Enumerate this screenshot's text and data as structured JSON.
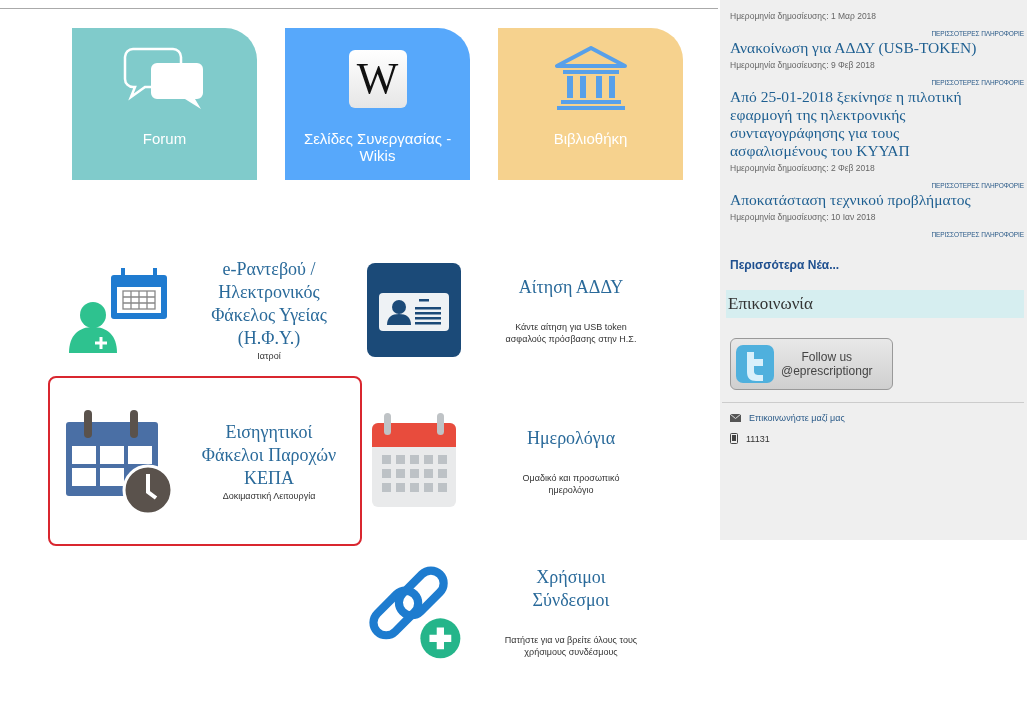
{
  "tiles": [
    {
      "kind": "forum",
      "label": "Forum",
      "color": "#80cbcb"
    },
    {
      "kind": "wiki",
      "label": "Σελίδες Συνεργασίας - Wikis",
      "color": "#57a8fb",
      "icon_text": "W"
    },
    {
      "kind": "library",
      "label": "Βιβλιοθήκη",
      "color": "#f6d28e"
    }
  ],
  "services": [
    {
      "kind": "doctor",
      "title": "e-Ραντεβού / Ηλεκτρονικός Φάκελος Υγείας (Η.Φ.Υ.)",
      "subtitle": "Ιατροί",
      "highlighted": false
    },
    {
      "kind": "card",
      "title": "Αίτηση ΑΔΔΥ",
      "subtitle": "Κάντε αίτηση για USB token ασφαλούς πρόσβασης στην Η.Σ.",
      "highlighted": false
    },
    {
      "kind": "calendar-clock",
      "title": "Εισηγητικοί Φάκελοι Παροχών ΚΕΠΑ",
      "subtitle": "Δοκιμαστική Λειτουργία",
      "highlighted": true
    },
    {
      "kind": "calendar",
      "title": "Ημερολόγια",
      "subtitle": "Ομαδικό και προσωπικό ημερολόγιο",
      "highlighted": false
    },
    {
      "kind": "empty"
    },
    {
      "kind": "links",
      "title": "Χρήσιμοι Σύνδεσμοι",
      "subtitle": "Πατήστε για να βρείτε όλους τους χρήσιμους συνδέσμους",
      "highlighted": false
    }
  ],
  "sidebar": {
    "news": [
      {
        "date": "Ημερομηνία δημοσίευσης: 1 Μαρ 2018",
        "more": "ΠΕΡΙΣΣΟΤΕΡΕΣ ΠΛΗΡΟΦΟΡΙΕ"
      },
      {
        "title": "Ανακοίνωση για ΑΔΔΥ (USB-TOKEN)",
        "date": "Ημερομηνία δημοσίευσης: 9 Φεβ 2018",
        "more": "ΠΕΡΙΣΣΟΤΕΡΕΣ ΠΛΗΡΟΦΟΡΙΕ"
      },
      {
        "title": "Από 25-01-2018 ξεκίνησε η πιλοτική εφαρμογή της ηλεκτρονικής συνταγογράφησης για τους ασφαλισμένους του ΚΥΥΑΠ",
        "date": "Ημερομηνία δημοσίευσης: 2 Φεβ 2018",
        "more": "ΠΕΡΙΣΣΟΤΕΡΕΣ ΠΛΗΡΟΦΟΡΙΕ"
      },
      {
        "title": "Αποκατάσταση τεχνικού προβλήματος",
        "date": "Ημερομηνία δημοσίευσης: 10 Ιαν 2018",
        "more": "ΠΕΡΙΣΣΟΤΕΡΕΣ ΠΛΗΡΟΦΟΡΙΕ"
      }
    ],
    "more_news": "Περισσότερα Νέα...",
    "contact_heading": "Επικοινωνία",
    "twitter": {
      "line1": "Follow us",
      "line2": "@eprescriptiongr"
    },
    "contacts": [
      {
        "kind": "mail",
        "text": "Επικοινωνήστε μαζί μας"
      },
      {
        "kind": "phone",
        "text": "11131"
      }
    ]
  }
}
